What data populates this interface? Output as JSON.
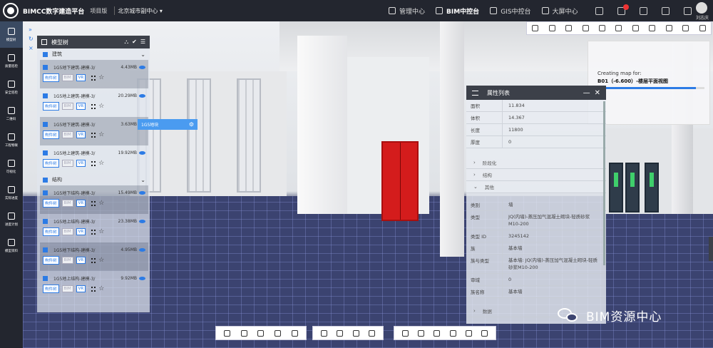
{
  "header": {
    "brand": "BIMCC数字建造平台",
    "project": "项目版",
    "city": "北京城市副中心",
    "nav": [
      {
        "label": "管理中心",
        "active": false
      },
      {
        "label": "BIM中控台",
        "active": true
      },
      {
        "label": "GIS中控台",
        "active": false
      },
      {
        "label": "大屏中心",
        "active": false
      }
    ],
    "user": "刘志庆"
  },
  "sidebar": {
    "items": [
      {
        "label": "模型树",
        "icon": "cube-icon",
        "active": true
      },
      {
        "label": "质量巡检",
        "icon": "shield-icon",
        "active": false
      },
      {
        "label": "安全巡检",
        "icon": "helmet-icon",
        "active": false
      },
      {
        "label": "二维码",
        "icon": "qrcode-icon",
        "active": false
      },
      {
        "label": "工程物联",
        "icon": "network-icon",
        "active": false
      },
      {
        "label": "可视化",
        "icon": "monitor-icon",
        "active": false
      },
      {
        "label": "实际进度",
        "icon": "clock-icon",
        "active": false
      },
      {
        "label": "进度计划",
        "icon": "plan-icon",
        "active": false
      },
      {
        "label": "模型资料",
        "icon": "folder-icon",
        "active": false
      }
    ]
  },
  "tree": {
    "title": "模型树",
    "groups": [
      {
        "label": "建筑",
        "items": [
          {
            "name": "1G5地下建筑-建模-3/",
            "size": "4.43MB",
            "tag1": "构件树",
            "tag2": "VR"
          },
          {
            "name": "1G5地上建筑-建模-3/",
            "size": "20.29MB",
            "tag1": "构件树",
            "tag2": "VR"
          },
          {
            "name": "1G5地下建筑-建模-3/",
            "size": "3.63MB",
            "tag1": "构件树",
            "tag2": "VR"
          },
          {
            "name": "1G5地上建筑-建模-3/",
            "size": "19.92MB",
            "tag1": "构件树",
            "tag2": "VR"
          }
        ]
      },
      {
        "label": "结构",
        "items": [
          {
            "name": "1G5地下结构-建模-3/",
            "size": "15.49MB",
            "tag1": "构件树",
            "tag2": "VR"
          },
          {
            "name": "1G5地上结构-建模-3/",
            "size": "23.38MB",
            "tag1": "构件树",
            "tag2": "VR"
          },
          {
            "name": "1G5地下结构-建模-3/",
            "size": "4.95MB",
            "tag1": "构件树",
            "tag2": "VR"
          },
          {
            "name": "1G5地上结构-建模-3/",
            "size": "9.92MB",
            "tag1": "构件树",
            "tag2": "VR"
          }
        ]
      }
    ],
    "tag_gray": "BIM"
  },
  "tooltip": {
    "label": "1G5地块"
  },
  "progress": {
    "line1": "Creating map for:",
    "line2": "B01（-6.600）-楼层平面视图",
    "fraction": 0.92
  },
  "props": {
    "title": "属性列表",
    "top_rows": [
      {
        "k": "面积",
        "v": "11.834"
      },
      {
        "k": "体积",
        "v": "14.367"
      },
      {
        "k": "长度",
        "v": "11800"
      },
      {
        "k": "厚度",
        "v": "0"
      }
    ],
    "sections": [
      "阶段化",
      "结构",
      "其他"
    ],
    "other_rows": [
      {
        "k": "类别",
        "v": "墙"
      },
      {
        "k": "类型",
        "v": "JQ(内墙)-蒸压加气混凝土砌块-轻质砂浆M10-200"
      },
      {
        "k": "类型 ID",
        "v": "3245142"
      },
      {
        "k": "族",
        "v": "基本墙"
      },
      {
        "k": "族与类型",
        "v": "基本墙: JQ(内墙)-蒸压加气混凝土砌块-轻质砂浆M10-200"
      },
      {
        "k": "审域",
        "v": "0"
      },
      {
        "k": "族名称",
        "v": "基本墙"
      }
    ],
    "last_section": "数据"
  },
  "watermark": "BIM资源中心",
  "colors": {
    "accent": "#2c7be5",
    "topbar": "#23262f",
    "door": "#d41c1c"
  }
}
